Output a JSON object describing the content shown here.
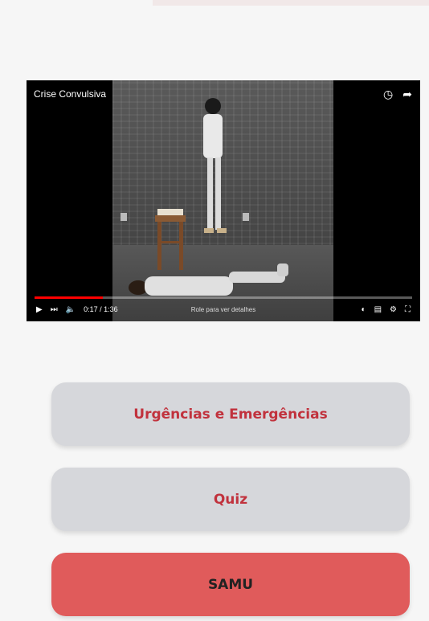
{
  "video": {
    "title": "Crise Convulsiva",
    "time_text": "0:17 / 1:36",
    "progress_fraction": 0.18,
    "hint": "Role para ver detalhes",
    "icons": [
      "clock-icon",
      "share-icon",
      "play-icon",
      "next-icon",
      "volume-icon",
      "autoplay-toggle-icon",
      "subtitles-icon",
      "settings-icon",
      "fullscreen-icon"
    ]
  },
  "buttons": {
    "urgencias": "Urgências e Emergências",
    "quiz": "Quiz",
    "samu": "SAMU"
  },
  "colors": {
    "button_gray": "#d6d7db",
    "button_red": "#e05b5b",
    "text_red": "#c1323d",
    "progress": "#ff0000"
  }
}
